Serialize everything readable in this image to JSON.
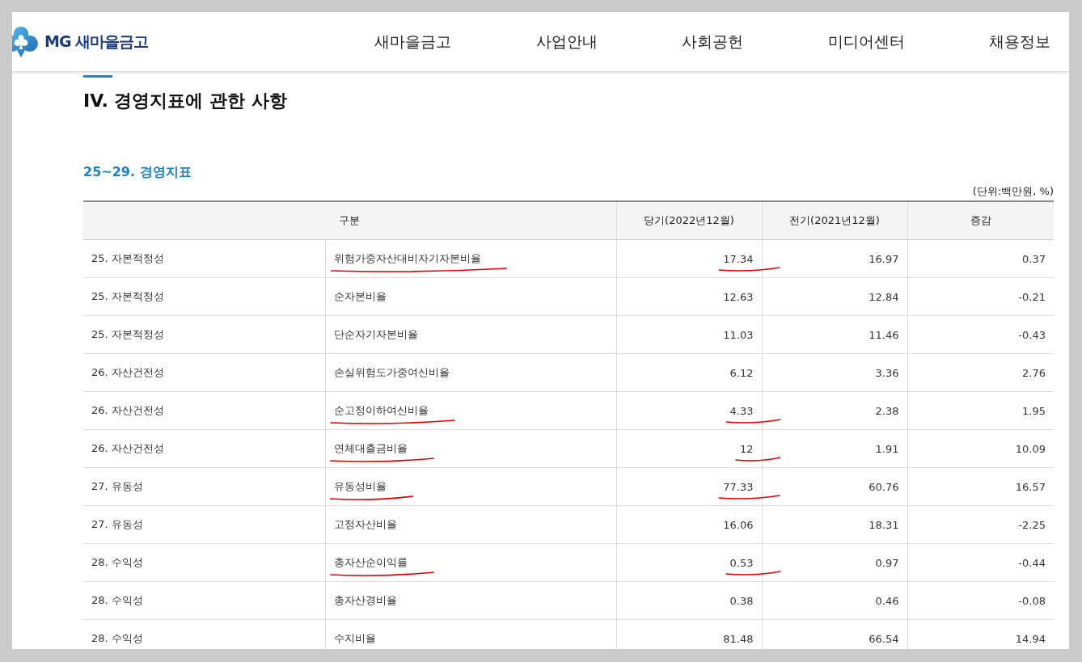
{
  "header": {
    "logo": "MG 새마을금고",
    "nav": [
      "새마을금고",
      "사업안내",
      "사회공헌",
      "미디어센터",
      "채용정보"
    ]
  },
  "section_title": "IV. 경영지표에 관한 사항",
  "subsection_title": "25~29. 경영지표",
  "unit": "(단위:백만원, %)",
  "table": {
    "columns": [
      "구분",
      "당기(2022년12월)",
      "전기(2021년12월)",
      "증감"
    ],
    "rows": [
      {
        "category": "25. 자본적정성",
        "item": "위험가중자산대비자기자본비율",
        "current": "17.34",
        "previous": "16.97",
        "change": "0.37",
        "underlined": true
      },
      {
        "category": "25. 자본적정성",
        "item": "순자본비율",
        "current": "12.63",
        "previous": "12.84",
        "change": "-0.21",
        "underlined": false
      },
      {
        "category": "25. 자본적정성",
        "item": "단순자기자본비율",
        "current": "11.03",
        "previous": "11.46",
        "change": "-0.43",
        "underlined": false
      },
      {
        "category": "26. 자산건전성",
        "item": "손실위험도가중여신비율",
        "current": "6.12",
        "previous": "3.36",
        "change": "2.76",
        "underlined": false
      },
      {
        "category": "26. 자산건전성",
        "item": "순고정이하여신비율",
        "current": "4.33",
        "previous": "2.38",
        "change": "1.95",
        "underlined": true
      },
      {
        "category": "26. 자산건전성",
        "item": "연체대출금비율",
        "current": "12",
        "previous": "1.91",
        "change": "10.09",
        "underlined": true
      },
      {
        "category": "27. 유동성",
        "item": "유동성비율",
        "current": "77.33",
        "previous": "60.76",
        "change": "16.57",
        "underlined": true
      },
      {
        "category": "27. 유동성",
        "item": "고정자산비율",
        "current": "16.06",
        "previous": "18.31",
        "change": "-2.25",
        "underlined": false
      },
      {
        "category": "28. 수익성",
        "item": "총자산순이익률",
        "current": "0.53",
        "previous": "0.97",
        "change": "-0.44",
        "underlined": true
      },
      {
        "category": "28. 수익성",
        "item": "총자산경비율",
        "current": "0.38",
        "previous": "0.46",
        "change": "-0.08",
        "underlined": false
      },
      {
        "category": "28. 수익성",
        "item": "수지비율",
        "current": "81.48",
        "previous": "66.54",
        "change": "14.94",
        "underlined": false
      }
    ]
  }
}
